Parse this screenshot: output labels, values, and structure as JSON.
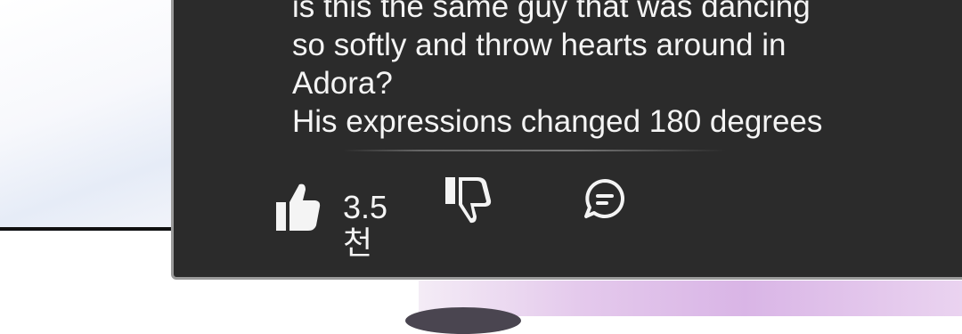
{
  "comment": {
    "lines": [
      "is this the same guy that was dancing",
      "so softly and throw hearts around in",
      "Adora?",
      "His expressions changed 180 degrees"
    ]
  },
  "actions": {
    "like_count": "3.5천",
    "like_icon": "thumbs-up-icon",
    "dislike_icon": "thumbs-down-icon",
    "reply_icon": "comment-bubble-icon"
  },
  "colors": {
    "panel_bg": "#2b2b2b",
    "text": "#f4f4f4"
  }
}
